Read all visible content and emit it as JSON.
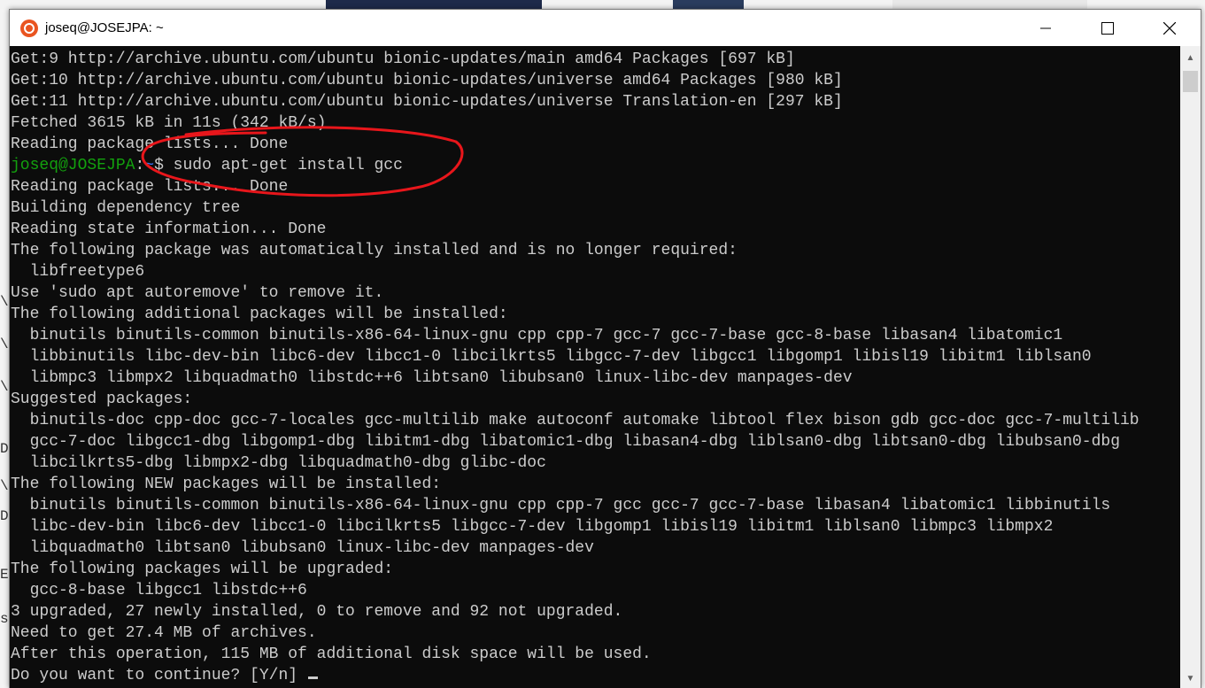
{
  "window": {
    "title": "joseq@JOSEJPA: ~",
    "icon": "ubuntu-icon",
    "controls": [
      "minimize",
      "maximize",
      "close"
    ]
  },
  "terminal": {
    "lines_before_prompt": [
      "Get:9 http://archive.ubuntu.com/ubuntu bionic-updates/main amd64 Packages [697 kB]",
      "Get:10 http://archive.ubuntu.com/ubuntu bionic-updates/universe amd64 Packages [980 kB]",
      "Get:11 http://archive.ubuntu.com/ubuntu bionic-updates/universe Translation-en [297 kB]",
      "Fetched 3615 kB in 11s (342 kB/s)",
      "Reading package lists... Done"
    ],
    "prompt_user": "joseq@JOSEJPA",
    "prompt_sep": ":",
    "prompt_path": "~",
    "prompt_symbol": "$ ",
    "command": "sudo apt-get install gcc",
    "lines_after_prompt": [
      "Reading package lists... Done",
      "Building dependency tree",
      "Reading state information... Done",
      "The following package was automatically installed and is no longer required:",
      "  libfreetype6",
      "Use 'sudo apt autoremove' to remove it.",
      "The following additional packages will be installed:",
      "  binutils binutils-common binutils-x86-64-linux-gnu cpp cpp-7 gcc-7 gcc-7-base gcc-8-base libasan4 libatomic1",
      "  libbinutils libc-dev-bin libc6-dev libcc1-0 libcilkrts5 libgcc-7-dev libgcc1 libgomp1 libisl19 libitm1 liblsan0",
      "  libmpc3 libmpx2 libquadmath0 libstdc++6 libtsan0 libubsan0 linux-libc-dev manpages-dev",
      "Suggested packages:",
      "  binutils-doc cpp-doc gcc-7-locales gcc-multilib make autoconf automake libtool flex bison gdb gcc-doc gcc-7-multilib",
      "  gcc-7-doc libgcc1-dbg libgomp1-dbg libitm1-dbg libatomic1-dbg libasan4-dbg liblsan0-dbg libtsan0-dbg libubsan0-dbg",
      "  libcilkrts5-dbg libmpx2-dbg libquadmath0-dbg glibc-doc",
      "The following NEW packages will be installed:",
      "  binutils binutils-common binutils-x86-64-linux-gnu cpp cpp-7 gcc gcc-7 gcc-7-base libasan4 libatomic1 libbinutils",
      "  libc-dev-bin libc6-dev libcc1-0 libcilkrts5 libgcc-7-dev libgomp1 libisl19 libitm1 liblsan0 libmpc3 libmpx2",
      "  libquadmath0 libtsan0 libubsan0 linux-libc-dev manpages-dev",
      "The following packages will be upgraded:",
      "  gcc-8-base libgcc1 libstdc++6",
      "3 upgraded, 27 newly installed, 0 to remove and 92 not upgraded.",
      "Need to get 27.4 MB of archives.",
      "After this operation, 115 MB of additional disk space will be used."
    ],
    "final_prompt": "Do you want to continue? [Y/n] "
  },
  "colors": {
    "terminal_bg": "#0c0c0c",
    "terminal_fg": "#cccccc",
    "prompt_user": "#13a10e",
    "prompt_path": "#3b78ff",
    "annotation": "#e8161b"
  }
}
